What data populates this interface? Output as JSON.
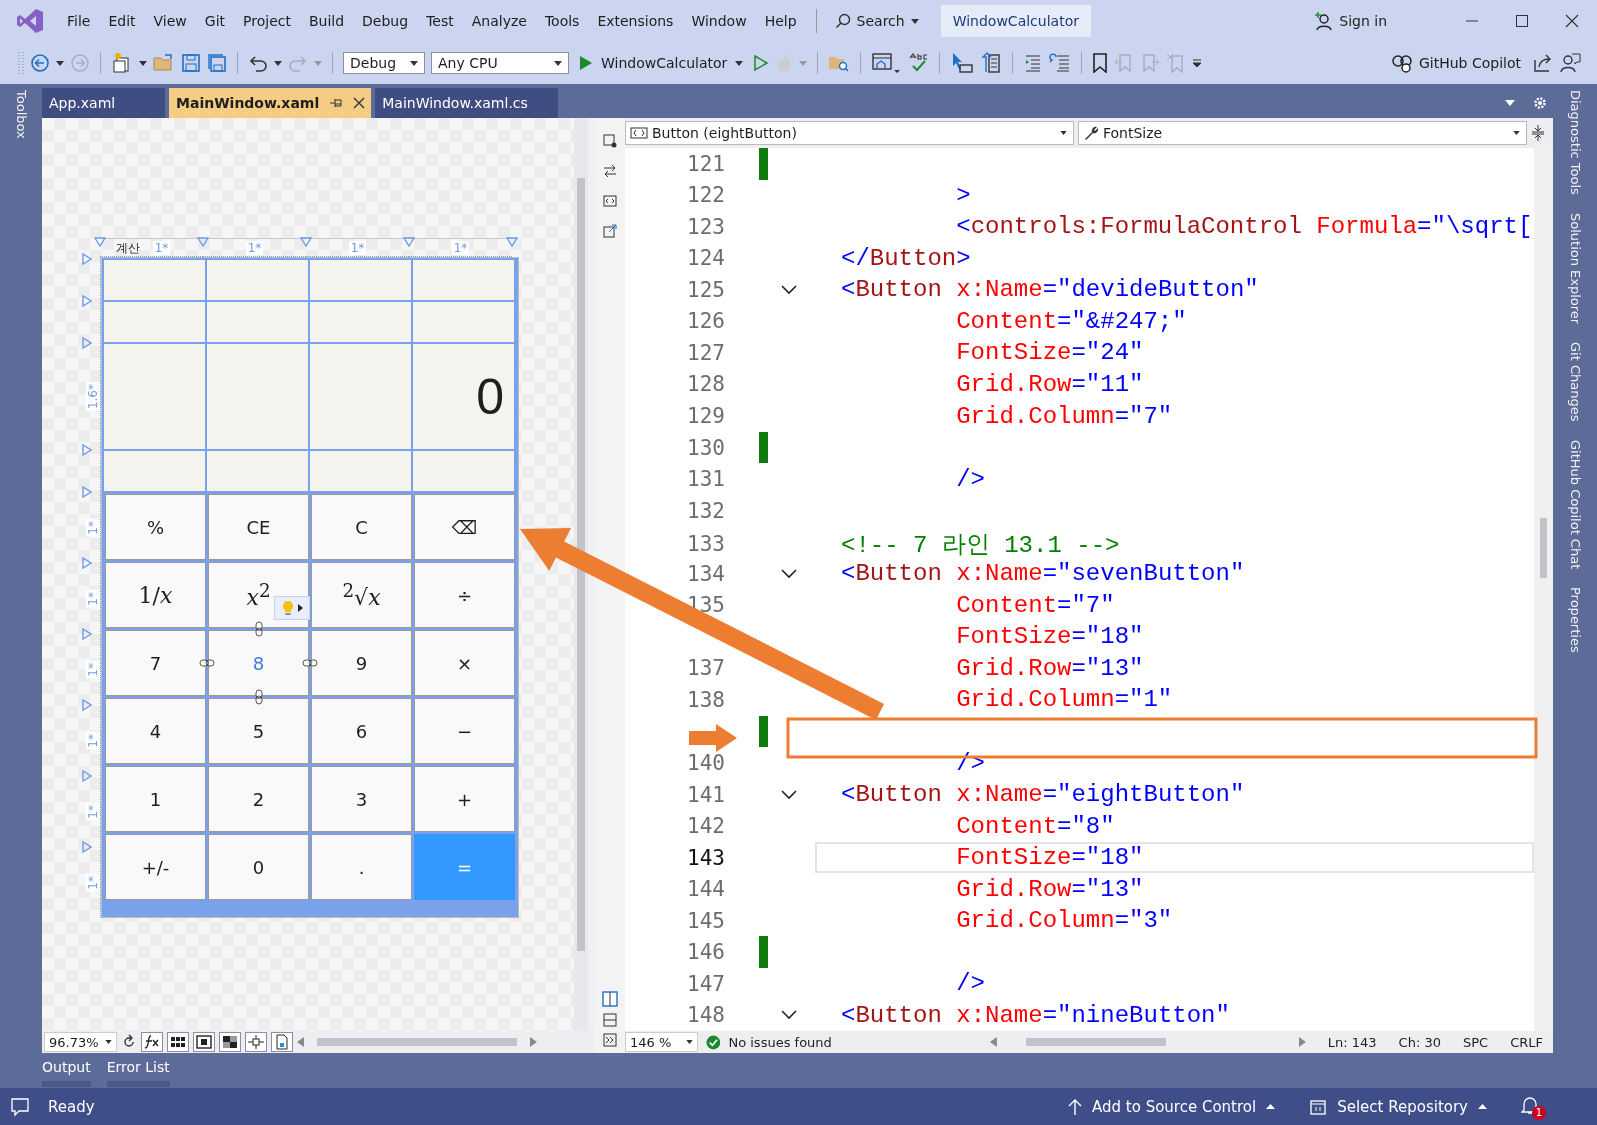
{
  "menu_bar": {
    "items": [
      "File",
      "Edit",
      "View",
      "Git",
      "Project",
      "Build",
      "Debug",
      "Test",
      "Analyze",
      "Tools",
      "Extensions",
      "Window",
      "Help"
    ],
    "search": "Search",
    "solution": "WindowCalculator",
    "sign_in": "Sign in"
  },
  "toolbar": {
    "configuration": "Debug",
    "platform": "Any CPU",
    "run_target": "WindowCalculator",
    "copilot": "GitHub Copilot"
  },
  "left_rail": [
    "Toolbox"
  ],
  "document_tabs": [
    {
      "label": "App.xaml",
      "selected": false
    },
    {
      "label": "MainWindow.xaml",
      "selected": true
    },
    {
      "label": "MainWindow.xaml.cs",
      "selected": false
    }
  ],
  "designer": {
    "window_title": "계산",
    "column_sizes": [
      "1*",
      "1*",
      "1*",
      "1*"
    ],
    "rows": [
      {
        "kind": "header"
      },
      {
        "kind": "header"
      },
      {
        "kind": "result",
        "label": "1.6*"
      },
      {
        "kind": "header"
      },
      {
        "kind": "button",
        "label": "1*"
      },
      {
        "kind": "button",
        "label": "1*"
      },
      {
        "kind": "button",
        "label": "1*"
      },
      {
        "kind": "button",
        "label": "1*"
      },
      {
        "kind": "button",
        "label": "1*"
      },
      {
        "kind": "button",
        "label": "1*"
      }
    ],
    "display": "0",
    "buttons": [
      {
        "label": "%",
        "kind": "text",
        "selected": false,
        "lightbulb": false
      },
      {
        "label": "CE",
        "kind": "text",
        "selected": false,
        "lightbulb": false
      },
      {
        "label": "C",
        "kind": "text",
        "selected": false,
        "lightbulb": false
      },
      {
        "label": "⌫",
        "kind": "text",
        "selected": false,
        "lightbulb": false
      },
      {
        "label": "1/*x*",
        "kind": "formula",
        "selected": false,
        "lightbulb": false
      },
      {
        "label": "*x*$^{2}$",
        "kind": "formula",
        "selected": false,
        "lightbulb": true
      },
      {
        "label": "$^{2}$√*x*",
        "kind": "formula",
        "selected": false,
        "lightbulb": false
      },
      {
        "label": "÷",
        "kind": "text",
        "selected": false,
        "lightbulb": false
      },
      {
        "label": "7",
        "kind": "text",
        "selected": false,
        "lightbulb": false
      },
      {
        "label": "8",
        "kind": "text",
        "selected": true,
        "lightbulb": false
      },
      {
        "label": "9",
        "kind": "text",
        "selected": false,
        "lightbulb": false
      },
      {
        "label": "×",
        "kind": "text",
        "selected": false,
        "lightbulb": false
      },
      {
        "label": "4",
        "kind": "text",
        "selected": false,
        "lightbulb": false
      },
      {
        "label": "5",
        "kind": "text",
        "selected": false,
        "lightbulb": false
      },
      {
        "label": "6",
        "kind": "text",
        "selected": false,
        "lightbulb": false
      },
      {
        "label": "−",
        "kind": "text",
        "selected": false,
        "lightbulb": false
      },
      {
        "label": "1",
        "kind": "text",
        "selected": false,
        "lightbulb": false
      },
      {
        "label": "2",
        "kind": "text",
        "selected": false,
        "lightbulb": false
      },
      {
        "label": "3",
        "kind": "text",
        "selected": false,
        "lightbulb": false
      },
      {
        "label": "+",
        "kind": "text",
        "selected": false,
        "lightbulb": false
      },
      {
        "label": "+/-",
        "kind": "text",
        "selected": false,
        "lightbulb": false
      },
      {
        "label": "0",
        "kind": "text",
        "selected": false,
        "lightbulb": false
      },
      {
        "label": ".",
        "kind": "text",
        "selected": false,
        "lightbulb": false
      },
      {
        "label": "=",
        "kind": "accent",
        "selected": false,
        "lightbulb": false
      }
    ],
    "zoom": "96.73%"
  },
  "editor": {
    "member_dropdown": "Button (eightButton)",
    "property_dropdown": "FontSize",
    "lines": [
      {
        "number": "121",
        "changed": true,
        "foldable": false,
        "current": false
      },
      {
        "number": "122",
        "changed": false,
        "foldable": false,
        "current": false,
        "tokens": [
          {
            "kind": "bracket",
            "text": "        >"
          }
        ]
      },
      {
        "number": "123",
        "changed": false,
        "foldable": false,
        "current": false,
        "tokens": [
          {
            "kind": "bracket",
            "text": "        <"
          },
          {
            "kind": "element",
            "text": "controls:FormulaControl"
          },
          {
            "kind": "attribute",
            "text": " Formula"
          },
          {
            "kind": "bracket",
            "text": "="
          },
          {
            "kind": "value",
            "text": "\"\\sqrt["
          }
        ]
      },
      {
        "number": "124",
        "changed": false,
        "foldable": false,
        "current": false,
        "tokens": [
          {
            "kind": "bracket",
            "text": "</"
          },
          {
            "kind": "element",
            "text": "Button"
          },
          {
            "kind": "bracket",
            "text": ">"
          }
        ]
      },
      {
        "number": "125",
        "changed": false,
        "foldable": true,
        "current": false,
        "tokens": [
          {
            "kind": "bracket",
            "text": "<"
          },
          {
            "kind": "element",
            "text": "Button"
          },
          {
            "kind": "attribute",
            "text": " x:Name"
          },
          {
            "kind": "bracket",
            "text": "="
          },
          {
            "kind": "value",
            "text": "\"devideButton\""
          }
        ]
      },
      {
        "number": "126",
        "changed": false,
        "foldable": false,
        "current": false,
        "tokens": [
          {
            "kind": "attribute",
            "text": "        Content"
          },
          {
            "kind": "bracket",
            "text": "="
          },
          {
            "kind": "value",
            "text": "\"&#247;\""
          }
        ]
      },
      {
        "number": "127",
        "changed": false,
        "foldable": false,
        "current": false,
        "tokens": [
          {
            "kind": "attribute",
            "text": "        FontSize"
          },
          {
            "kind": "bracket",
            "text": "="
          },
          {
            "kind": "value",
            "text": "\"24\""
          }
        ]
      },
      {
        "number": "128",
        "changed": false,
        "foldable": false,
        "current": false,
        "tokens": [
          {
            "kind": "attribute",
            "text": "        Grid.Row"
          },
          {
            "kind": "bracket",
            "text": "="
          },
          {
            "kind": "value",
            "text": "\"11\""
          }
        ]
      },
      {
        "number": "129",
        "changed": false,
        "foldable": false,
        "current": false,
        "tokens": [
          {
            "kind": "attribute",
            "text": "        Grid.Column"
          },
          {
            "kind": "bracket",
            "text": "="
          },
          {
            "kind": "value",
            "text": "\"7\""
          }
        ]
      },
      {
        "number": "130",
        "changed": true,
        "foldable": false,
        "current": false
      },
      {
        "number": "131",
        "changed": false,
        "foldable": false,
        "current": false,
        "tokens": [
          {
            "kind": "bracket",
            "text": "        />"
          }
        ]
      },
      {
        "number": "132",
        "changed": false,
        "foldable": false,
        "current": false
      },
      {
        "number": "133",
        "changed": false,
        "foldable": false,
        "current": false,
        "tokens": [
          {
            "kind": "comment",
            "text": "<!-- 7 라인 13.1 -->"
          }
        ]
      },
      {
        "number": "134",
        "changed": false,
        "foldable": true,
        "current": false,
        "tokens": [
          {
            "kind": "bracket",
            "text": "<"
          },
          {
            "kind": "element",
            "text": "Button"
          },
          {
            "kind": "attribute",
            "text": " x:Name"
          },
          {
            "kind": "bracket",
            "text": "="
          },
          {
            "kind": "value",
            "text": "\"sevenButton\""
          }
        ]
      },
      {
        "number": "135",
        "changed": false,
        "foldable": false,
        "current": false,
        "tokens": [
          {
            "kind": "attribute",
            "text": "        Content"
          },
          {
            "kind": "bracket",
            "text": "="
          },
          {
            "kind": "value",
            "text": "\"7\""
          }
        ]
      },
      {
        "changed": false,
        "foldable": false,
        "current": false,
        "tokens": [
          {
            "kind": "attribute",
            "text": "        FontSize"
          },
          {
            "kind": "bracket",
            "text": "="
          },
          {
            "kind": "value",
            "text": "\"18\""
          }
        ]
      },
      {
        "number": "137",
        "changed": false,
        "foldable": false,
        "current": false,
        "tokens": [
          {
            "kind": "attribute",
            "text": "        Grid.Row"
          },
          {
            "kind": "bracket",
            "text": "="
          },
          {
            "kind": "value",
            "text": "\"13\""
          }
        ]
      },
      {
        "number": "138",
        "changed": false,
        "foldable": false,
        "current": false,
        "tokens": [
          {
            "kind": "attribute",
            "text": "        Grid.Column"
          },
          {
            "kind": "bracket",
            "text": "="
          },
          {
            "kind": "value",
            "text": "\"1\""
          }
        ]
      },
      {
        "changed": true,
        "foldable": false,
        "current": false
      },
      {
        "number": "140",
        "changed": false,
        "foldable": false,
        "current": false,
        "tokens": [
          {
            "kind": "bracket",
            "text": "        />"
          }
        ]
      },
      {
        "number": "141",
        "changed": false,
        "foldable": true,
        "current": false,
        "tokens": [
          {
            "kind": "bracket",
            "text": "<"
          },
          {
            "kind": "element",
            "text": "Button"
          },
          {
            "kind": "attribute",
            "text": " x:Name"
          },
          {
            "kind": "bracket",
            "text": "="
          },
          {
            "kind": "value",
            "text": "\"eightButton\""
          }
        ]
      },
      {
        "number": "142",
        "changed": false,
        "foldable": false,
        "current": false,
        "tokens": [
          {
            "kind": "attribute",
            "text": "        Content"
          },
          {
            "kind": "bracket",
            "text": "="
          },
          {
            "kind": "value",
            "text": "\"8\""
          }
        ]
      },
      {
        "number": "143",
        "changed": false,
        "foldable": false,
        "current": true,
        "tokens": [
          {
            "kind": "attribute",
            "text": "        FontSize"
          },
          {
            "kind": "bracket",
            "text": "="
          },
          {
            "kind": "value",
            "text": "\"18\""
          }
        ]
      },
      {
        "number": "144",
        "changed": false,
        "foldable": false,
        "current": false,
        "tokens": [
          {
            "kind": "attribute",
            "text": "        Grid.Row"
          },
          {
            "kind": "bracket",
            "text": "="
          },
          {
            "kind": "value",
            "text": "\"13\""
          }
        ]
      },
      {
        "number": "145",
        "changed": false,
        "foldable": false,
        "current": false,
        "tokens": [
          {
            "kind": "attribute",
            "text": "        Grid.Column"
          },
          {
            "kind": "bracket",
            "text": "="
          },
          {
            "kind": "value",
            "text": "\"3\""
          }
        ]
      },
      {
        "number": "146",
        "changed": true,
        "foldable": false,
        "current": false
      },
      {
        "number": "147",
        "changed": false,
        "foldable": false,
        "current": false,
        "tokens": [
          {
            "kind": "bracket",
            "text": "        />"
          }
        ]
      },
      {
        "number": "148",
        "changed": false,
        "foldable": true,
        "current": false,
        "tokens": [
          {
            "kind": "bracket",
            "text": "<"
          },
          {
            "kind": "element",
            "text": "Button"
          },
          {
            "kind": "attribute",
            "text": " x:Name"
          },
          {
            "kind": "bracket",
            "text": "="
          },
          {
            "kind": "value",
            "text": "\"nineButton\""
          }
        ]
      }
    ],
    "zoom": "146 %",
    "issues": "No issues found",
    "line": "Ln: 143",
    "column": "Ch: 30",
    "indent": "SPC",
    "line_ending": "CRLF"
  },
  "right_rail": [
    "Diagnostic Tools",
    "Solution Explorer",
    "Git Changes",
    "GitHub Copilot Chat",
    "Properties"
  ],
  "bottom_tabs": [
    "Output",
    "Error List"
  ],
  "status_bar": {
    "state": "Ready",
    "source_control": "Add to Source Control",
    "repository": "Select Repository",
    "notifications": "1"
  }
}
